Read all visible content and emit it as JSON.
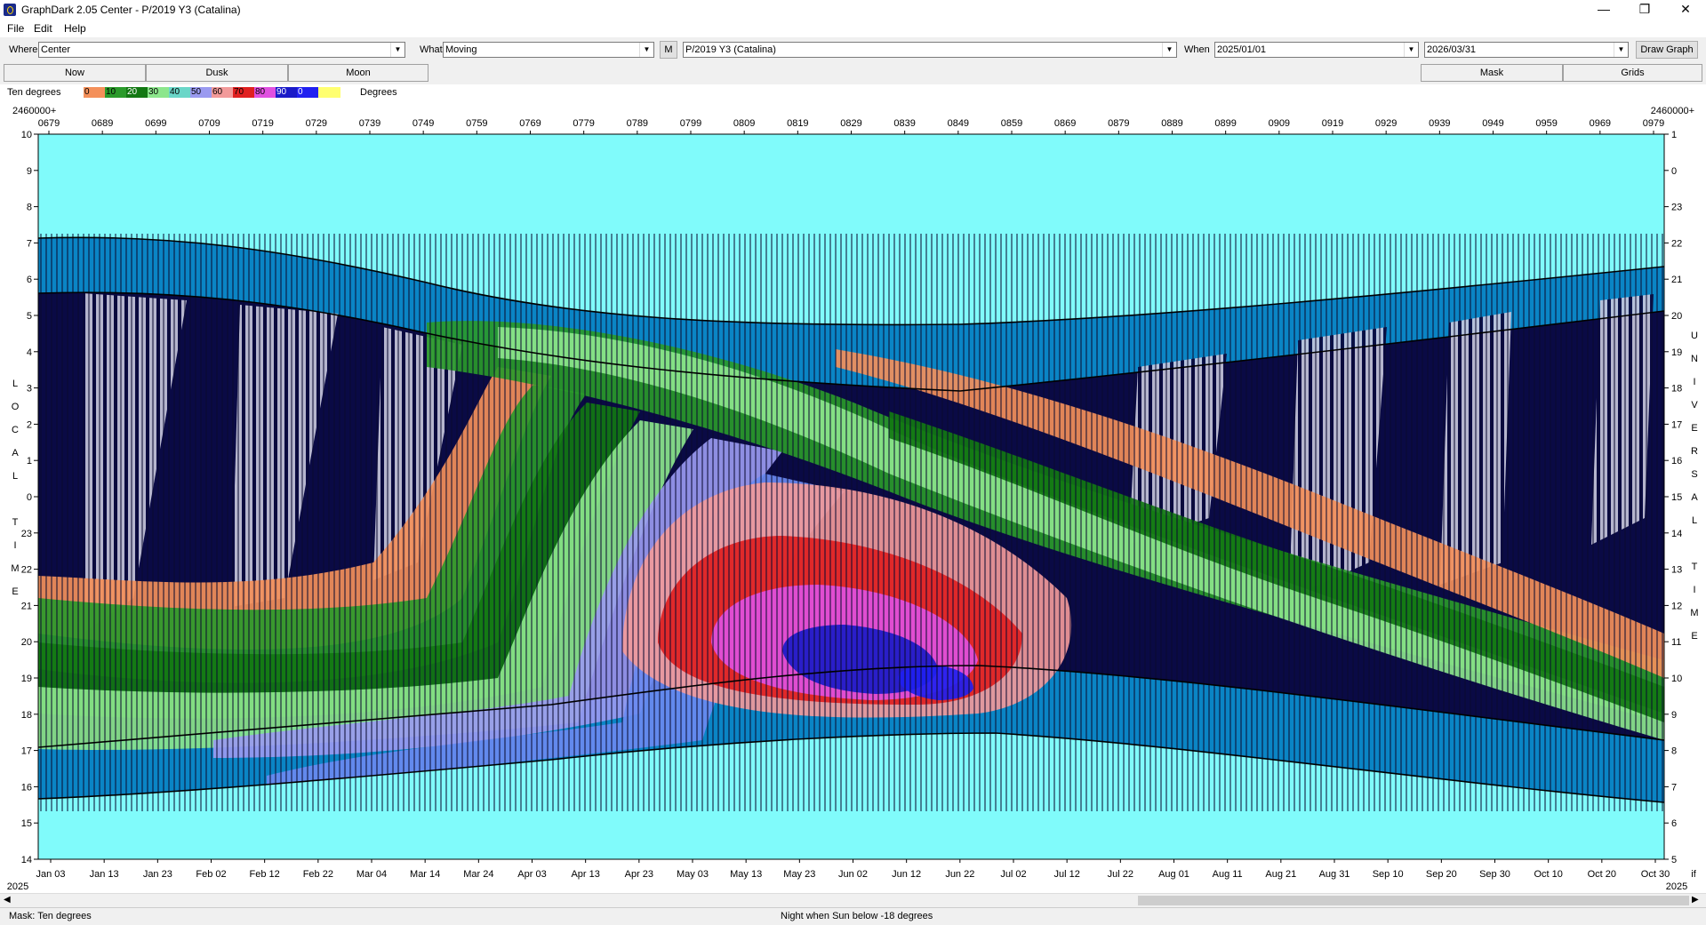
{
  "window": {
    "title": "GraphDark 2.05  Center  -  P/2019 Y3 (Catalina)"
  },
  "menu": [
    "File",
    "Edit",
    "Help"
  ],
  "toolbar": {
    "where_label": "Where",
    "where_value": "Center",
    "what_label": "What",
    "what_value": "Moving",
    "m_button": "M",
    "object_value": "P/2019 Y3 (Catalina)",
    "when_label": "When",
    "date_from": "2025/01/01",
    "date_to": "2026/03/31",
    "draw_button": "Draw Graph"
  },
  "buttons": {
    "now": "Now",
    "dusk": "Dusk",
    "moon": "Moon",
    "mask": "Mask",
    "grids": "Grids"
  },
  "legend": {
    "label": "Ten degrees",
    "unit": "Degrees",
    "swatches": [
      {
        "text": "0",
        "color": "#f4905a"
      },
      {
        "text": "10",
        "color": "#2a9a2a"
      },
      {
        "text": "20",
        "color": "#127812"
      },
      {
        "text": "30",
        "color": "#8ce68c"
      },
      {
        "text": "40",
        "color": "#6ad6c8"
      },
      {
        "text": "50",
        "color": "#9a9af0"
      },
      {
        "text": "60",
        "color": "#f29a9a"
      },
      {
        "text": "70",
        "color": "#e02020"
      },
      {
        "text": "80",
        "color": "#e050e0"
      },
      {
        "text": "90",
        "color": "#1a1ac8"
      },
      {
        "text": "0",
        "color": "#2020f0"
      },
      {
        "text": "",
        "color": "#ffff70"
      }
    ]
  },
  "graph": {
    "jd_prefix_left": "2460000+",
    "jd_prefix_right": "2460000+",
    "jd_labels": [
      "0679",
      "0689",
      "0699",
      "0709",
      "0719",
      "0729",
      "0739",
      "0749",
      "0759",
      "0769",
      "0779",
      "0789",
      "0799",
      "0809",
      "0819",
      "0829",
      "0839",
      "0849",
      "0859",
      "0869",
      "0879",
      "0889",
      "0899",
      "0909",
      "0919",
      "0929",
      "0939",
      "0949",
      "0959",
      "0969",
      "0979"
    ],
    "date_labels": [
      "Jan 03",
      "Jan 13",
      "Jan 23",
      "Feb 02",
      "Feb 12",
      "Feb 22",
      "Mar 04",
      "Mar 14",
      "Mar 24",
      "Apr 03",
      "Apr 13",
      "Apr 23",
      "May 03",
      "May 13",
      "May 23",
      "Jun 02",
      "Jun 12",
      "Jun 22",
      "Jul 02",
      "Jul 12",
      "Jul 22",
      "Aug 01",
      "Aug 11",
      "Aug 21",
      "Aug 31",
      "Sep 10",
      "Sep 20",
      "Sep 30",
      "Oct 10",
      "Oct 20",
      "Oct 30"
    ],
    "year_left": "2025",
    "year_right": "2025",
    "end_marker": "if",
    "left_axis_ticks": [
      "10",
      "9",
      "8",
      "7",
      "6",
      "5",
      "4",
      "3",
      "2",
      "1",
      "0",
      "23",
      "22",
      "21",
      "20",
      "19",
      "18",
      "17",
      "16",
      "15",
      "14"
    ],
    "right_axis_ticks": [
      "1",
      "0",
      "23",
      "22",
      "21",
      "20",
      "19",
      "18",
      "17",
      "16",
      "15",
      "14",
      "13",
      "12",
      "11",
      "10",
      "9",
      "8",
      "7",
      "6",
      "5"
    ],
    "left_axis_title": [
      "L",
      "O",
      "C",
      "A",
      "L",
      "",
      "T",
      "I",
      "M",
      "E"
    ],
    "right_axis_title": [
      "U",
      "N",
      "I",
      "V",
      "E",
      "R",
      "S",
      "A",
      "L",
      "",
      "T",
      "I",
      "M",
      "E"
    ],
    "colors": {
      "sky": "#80fbfb",
      "twilight": "#0a85c5",
      "night": "#0a0a45",
      "moonlight": "#c8c8dc"
    }
  },
  "status": {
    "left": "Mask:  Ten degrees",
    "center": "Night when Sun below -18 degrees"
  }
}
